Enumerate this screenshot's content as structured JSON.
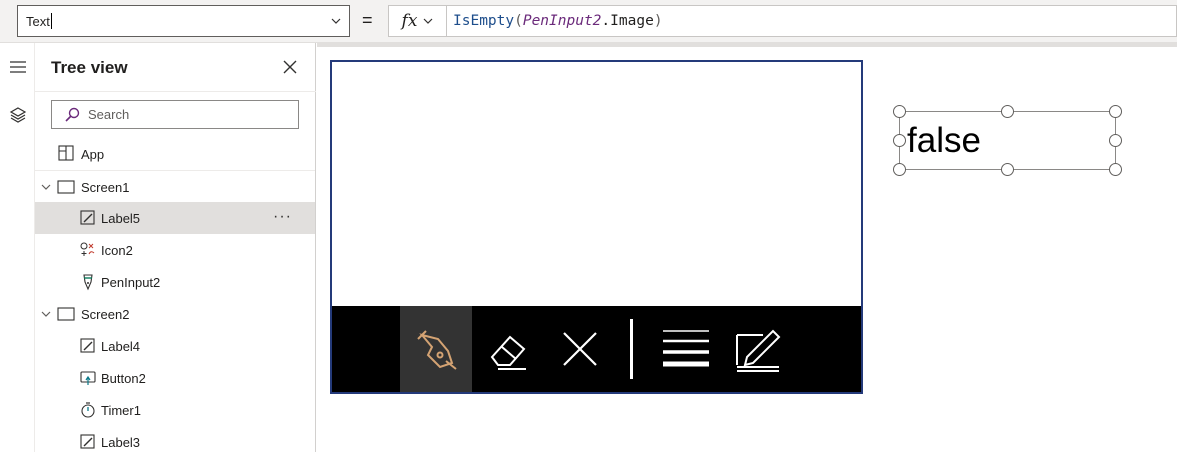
{
  "formula_bar": {
    "property_value": "Text",
    "equals": "=",
    "fx_label": "fx",
    "formula": {
      "function": "IsEmpty",
      "open": "(",
      "control": "PenInput2",
      "property": ".Image",
      "close": ")"
    }
  },
  "tree_view": {
    "title": "Tree view",
    "search_placeholder": "Search",
    "items": [
      {
        "label": "App",
        "icon": "app-icon"
      },
      {
        "label": "Screen1",
        "icon": "screen-icon"
      },
      {
        "label": "Label5",
        "icon": "label-icon",
        "selected": true
      },
      {
        "label": "Icon2",
        "icon": "icons-icon"
      },
      {
        "label": "PenInput2",
        "icon": "pen-input-icon"
      },
      {
        "label": "Screen2",
        "icon": "screen-icon"
      },
      {
        "label": "Label4",
        "icon": "label-icon"
      },
      {
        "label": "Button2",
        "icon": "button-icon"
      },
      {
        "label": "Timer1",
        "icon": "timer-icon"
      },
      {
        "label": "Label3",
        "icon": "label-icon"
      }
    ],
    "more_label": "···"
  },
  "canvas": {
    "label_value": "false",
    "pen_tools": [
      "pen-tool-icon",
      "eraser-icon",
      "clear-icon",
      "divider",
      "thickness-icon",
      "edit-icon"
    ]
  },
  "colors": {
    "accent": "#243a7a",
    "pen_active": "#d4a373",
    "selected_row": "#e1dfdd"
  }
}
